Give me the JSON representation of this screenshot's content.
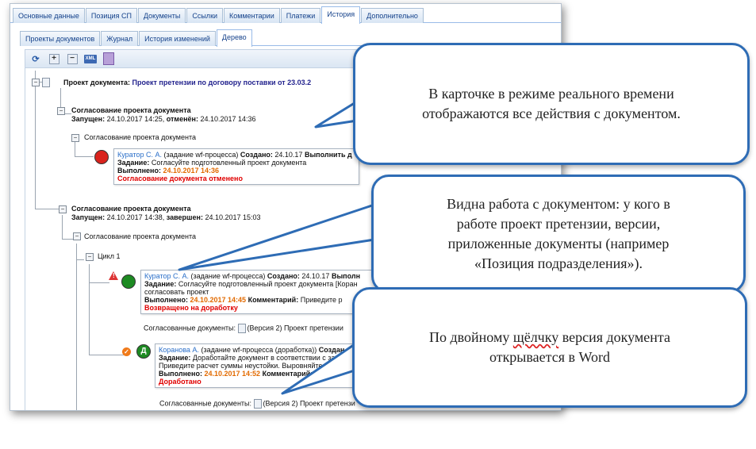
{
  "tabs_main": [
    "Основные данные",
    "Позиция СП",
    "Документы",
    "Ссылки",
    "Комментарии",
    "Платежи",
    "История",
    "Дополнительно"
  ],
  "tabs_main_active": "История",
  "tabs_sub": [
    "Проекты документов",
    "Журнал",
    "История изменений",
    "Дерево"
  ],
  "tabs_sub_active": "Дерево",
  "toolbar": [
    "refresh-icon",
    "expand-all-icon",
    "collapse-all-icon",
    "xml-export-icon",
    "document-icon"
  ],
  "tree": {
    "root_label": "Проект документа:",
    "root_value": "Проект претензии по договору поставки от 23.03.2",
    "process1": {
      "title": "Согласование проекта документа",
      "started_label": "Запущен:",
      "started_value": "24.10.2017 14:25,",
      "end_label": "отменён:",
      "end_value": "24.10.2017 14:36",
      "sub_title": "Согласование проекта документа",
      "task": {
        "assignee": "Куратор С. А.",
        "type": "(задание wf-процесса)",
        "created_label": "Создано:",
        "created_value": "24.10.17",
        "extra": "Выполнить д",
        "task_label": "Задание:",
        "task_text": "Согласуйте подготовленный проект документа",
        "done_label": "Выполнено:",
        "done_value": "24.10.2017 14:36",
        "result": "Согласование документа отменено"
      }
    },
    "process2": {
      "title": "Согласование проекта документа",
      "started_label": "Запущен:",
      "started_value": "24.10.2017 14:38,",
      "end_label": "завершен:",
      "end_value": "24.10.2017 15:03",
      "sub_title": "Согласование проекта документа",
      "cycle": "Цикл 1",
      "task1": {
        "assignee": "Куратор С. А.",
        "type": "(задание wf-процесса)",
        "created_label": "Создано:",
        "created_value": "24.10.17",
        "extra": "Выполн",
        "task_label": "Задание:",
        "task_text": "Согласуйте подготовленный проект документа  [Коран",
        "task_text2": "согласовать проект",
        "done_label": "Выполнено:",
        "done_value": "24.10.2017 14:45",
        "comment_label": "Комментарий:",
        "comment_value": "Приведите р",
        "result": "Возвращено на доработку"
      },
      "agreed_docs1_label": "Согласованные документы:",
      "agreed_docs1_value": "(Версия 2) Проект претензии",
      "task2": {
        "assignee": "Коранова А.",
        "type": "(задание wf-процесса (доработка))",
        "created_label": "Создан",
        "task_label": "Задание:",
        "task_text": "Доработайте документ в соответствии с зам",
        "task_text2": "Приведите расчет суммы неустойки. Выровняйте т",
        "done_label": "Выполнено:",
        "done_value": "24.10.2017 14:52",
        "comment_label": "Комментарий:",
        "result": "Доработано"
      },
      "agreed_docs2_label": "Согласованные документы:",
      "agreed_docs2_value": "(Версия 2) Проект претензи"
    }
  },
  "callouts": {
    "c1": "В карточке в режиме реального времени\nотображаются все действия с документом.",
    "c2": "Видна работа с документом: у кого в\nработе проект претензии, версии,\nприложенные документы (например\n«Позиция подразделения»).",
    "c3_a": "По двойному ",
    "c3_b": "щёлчку",
    "c3_c": " версия документа\nоткрывается в Word"
  },
  "colors": {
    "accent": "#2e6cb5",
    "tab_text": "#15428b",
    "link": "#2a6fc9",
    "date": "#e26a00",
    "status_red": "#e00000",
    "doc_name": "#23238e"
  }
}
